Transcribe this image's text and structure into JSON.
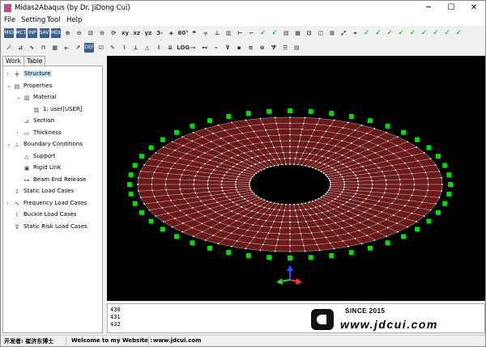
{
  "window": {
    "title": "Midas2Abaqus (by Dr. JiDong Cui)"
  },
  "menu": [
    "File",
    "Setting",
    "Tool",
    "Help"
  ],
  "toolbar1": [
    {
      "name": "open-icon",
      "glyph": "MID",
      "kind": "box"
    },
    {
      "name": "import-icon",
      "glyph": "MCT",
      "kind": "box"
    },
    {
      "name": "export-icon",
      "glyph": "INP",
      "kind": "box"
    },
    {
      "name": "save-icon",
      "glyph": "SAV",
      "kind": "box"
    },
    {
      "name": "model-icon",
      "glyph": "MDL",
      "kind": "box"
    },
    {
      "name": "zoom-in-icon",
      "glyph": "⊕",
      "kind": "dark"
    },
    {
      "name": "zoom-out-icon",
      "glyph": "⊖",
      "kind": "dark"
    },
    {
      "name": "zoom-window-icon",
      "glyph": "⊡",
      "kind": "dark"
    },
    {
      "name": "zoom-fit-icon",
      "glyph": "⊙",
      "kind": "dark"
    },
    {
      "name": "rotate-icon",
      "glyph": "⟳",
      "kind": "dark"
    },
    {
      "name": "view-xy-icon",
      "glyph": "xy",
      "kind": "dark"
    },
    {
      "name": "view-xz-icon",
      "glyph": "xz",
      "kind": "dark"
    },
    {
      "name": "view-yz-icon",
      "glyph": "yz",
      "kind": "dark"
    },
    {
      "name": "view-3d-icon",
      "glyph": "3-d",
      "kind": "dark"
    },
    {
      "name": "perspective-icon",
      "glyph": "◈",
      "kind": "dark"
    },
    {
      "name": "display-icon",
      "glyph": "60°",
      "kind": "dark"
    },
    {
      "name": "umbrella-icon",
      "glyph": "☂",
      "kind": "dark"
    },
    {
      "name": "mesh-icon",
      "glyph": "╤",
      "kind": "dark"
    },
    {
      "name": "beam-icon",
      "glyph": "⊥",
      "kind": "dark"
    },
    {
      "name": "frame-icon",
      "glyph": "▥",
      "kind": "dark"
    },
    {
      "name": "node-icon",
      "glyph": "⊢",
      "kind": "dark"
    },
    {
      "name": "element-icon",
      "glyph": "⌐",
      "kind": "dark"
    },
    {
      "name": "check-node-icon",
      "glyph": "✓",
      "kind": "green"
    },
    {
      "name": "check-element-icon",
      "glyph": "✓",
      "kind": "green"
    },
    {
      "name": "properties-icon",
      "glyph": "▤",
      "kind": "dark"
    },
    {
      "name": "grid-icon",
      "glyph": "▦",
      "kind": "dark"
    },
    {
      "name": "mirror-icon",
      "glyph": "⊟",
      "kind": "dark"
    },
    {
      "name": "plate-icon",
      "glyph": "◫",
      "kind": "dark"
    },
    {
      "name": "shell-icon",
      "glyph": "⊞",
      "kind": "dark"
    },
    {
      "name": "scale-icon",
      "glyph": "⤢",
      "kind": "dark"
    },
    {
      "name": "axis-icon",
      "glyph": "⌖",
      "kind": "dark"
    },
    {
      "name": "check-1-icon",
      "glyph": "✓",
      "kind": "green"
    },
    {
      "name": "check-2-icon",
      "glyph": "✓",
      "kind": "green"
    },
    {
      "name": "check-3-icon",
      "glyph": "✓",
      "kind": "green"
    },
    {
      "name": "check-4-icon",
      "glyph": "✓",
      "kind": "green"
    },
    {
      "name": "check-5-icon",
      "glyph": "✓",
      "kind": "green"
    },
    {
      "name": "check-6-icon",
      "glyph": "✓",
      "kind": "green"
    },
    {
      "name": "check-7-icon",
      "glyph": "✓",
      "kind": "green"
    },
    {
      "name": "check-8-icon",
      "glyph": "✓",
      "kind": "green"
    },
    {
      "name": "check-9-icon",
      "glyph": "✓",
      "kind": "green"
    }
  ],
  "toolbar2": [
    {
      "name": "line-element-icon",
      "glyph": "⟋",
      "kind": "dark"
    },
    {
      "name": "truss-icon",
      "glyph": "⊿",
      "kind": "dark"
    },
    {
      "name": "cable-icon",
      "glyph": "∿",
      "kind": "dark"
    },
    {
      "name": "section-icon",
      "glyph": "⊓",
      "kind": "dark"
    },
    {
      "name": "material-icon",
      "glyph": "▩",
      "kind": "dark"
    },
    {
      "name": "release-icon",
      "glyph": "⟜",
      "kind": "dark"
    },
    {
      "name": "local-axis-icon",
      "glyph": "↗",
      "kind": "dark"
    },
    {
      "name": "deform-icon",
      "glyph": "DEF",
      "kind": "box"
    },
    {
      "name": "confirm-icon",
      "glyph": "☑",
      "kind": "dark"
    },
    {
      "name": "draw-icon",
      "glyph": "✎",
      "kind": "dark"
    },
    {
      "name": "spring-icon",
      "glyph": "⌇",
      "kind": "dark"
    },
    {
      "name": "rigid-icon",
      "glyph": "⟂",
      "kind": "dark"
    },
    {
      "name": "support-icon",
      "glyph": "△",
      "kind": "dark"
    },
    {
      "name": "load-icon",
      "glyph": "⇩",
      "kind": "dark"
    },
    {
      "name": "pressure-icon",
      "glyph": "⇊",
      "kind": "dark"
    },
    {
      "name": "log-icon",
      "glyph": "LOG",
      "kind": "dark"
    },
    {
      "name": "node-load-icon",
      "glyph": "⊸",
      "kind": "dark"
    },
    {
      "name": "beam-load-icon",
      "glyph": "⊷",
      "kind": "dark"
    },
    {
      "name": "temp-icon",
      "glyph": "⌁",
      "kind": "dark"
    },
    {
      "name": "settlement-icon",
      "glyph": "⊽",
      "kind": "dark"
    },
    {
      "name": "mass-icon",
      "glyph": "▪",
      "kind": "dark"
    },
    {
      "name": "stage-icon",
      "glyph": "≋",
      "kind": "dark"
    },
    {
      "name": "result-icon",
      "glyph": "⊗",
      "kind": "dark"
    },
    {
      "name": "filter-icon",
      "glyph": "⧩",
      "kind": "dark"
    },
    {
      "name": "list-icon",
      "glyph": "☰",
      "kind": "dark"
    },
    {
      "name": "report-icon",
      "glyph": "▤",
      "kind": "dark"
    }
  ],
  "tabs": {
    "work": "Work",
    "table": "Table"
  },
  "tree": [
    {
      "label": "Structure",
      "level": 0,
      "exp": "›",
      "icon": "╪",
      "selected": true,
      "name": "tree-structure"
    },
    {
      "label": "Properties",
      "level": 0,
      "exp": "⌄",
      "icon": "▤",
      "name": "tree-properties"
    },
    {
      "label": "Material",
      "level": 1,
      "exp": "⌄",
      "icon": "▥",
      "name": "tree-material"
    },
    {
      "label": "1: user[USER]",
      "level": 2,
      "exp": "",
      "icon": "▥",
      "name": "tree-material-user"
    },
    {
      "label": "Section",
      "level": 1,
      "exp": "",
      "icon": "⊿",
      "name": "tree-section"
    },
    {
      "label": "Thickness",
      "level": 1,
      "exp": "›",
      "icon": "▭",
      "name": "tree-thickness"
    },
    {
      "label": "Boundary Conditions",
      "level": 0,
      "exp": "⌄",
      "icon": "⊥",
      "name": "tree-boundary-conditions"
    },
    {
      "label": "Support",
      "level": 1,
      "exp": "",
      "icon": "△",
      "name": "tree-support"
    },
    {
      "label": "Rigid Link",
      "level": 1,
      "exp": "",
      "icon": "▣",
      "name": "tree-rigid-link"
    },
    {
      "label": "Beam End Release",
      "level": 1,
      "exp": "",
      "icon": "⊶",
      "name": "tree-beam-end-release"
    },
    {
      "label": "Static Load Cases",
      "level": 0,
      "exp": "",
      "icon": "⇩",
      "name": "tree-static-load-cases"
    },
    {
      "label": "Frequency Load Cases",
      "level": 0,
      "exp": "›",
      "icon": "∿",
      "name": "tree-frequency-load-cases"
    },
    {
      "label": "Buckle Load Cases",
      "level": 0,
      "exp": "",
      "icon": "⌇",
      "name": "tree-buckle-load-cases"
    },
    {
      "label": "Static Risk Load Cases",
      "level": 0,
      "exp": "",
      "icon": "⊽",
      "name": "tree-static-risk-load-cases"
    }
  ],
  "console": {
    "lines": [
      "430",
      "431",
      "432"
    ]
  },
  "logo": {
    "since": "SINCE 2015",
    "url": "www.jdcui.com"
  },
  "status": {
    "developer": "开发者: 崔济东博士",
    "welcome": "Welcome to my Website :",
    "website": "www.jdcui.com"
  },
  "colors": {
    "mesh_fill": "#6b1a1a",
    "mesh_line": "#ffffff",
    "support": "#00e000",
    "viewport_bg": "#000000"
  }
}
